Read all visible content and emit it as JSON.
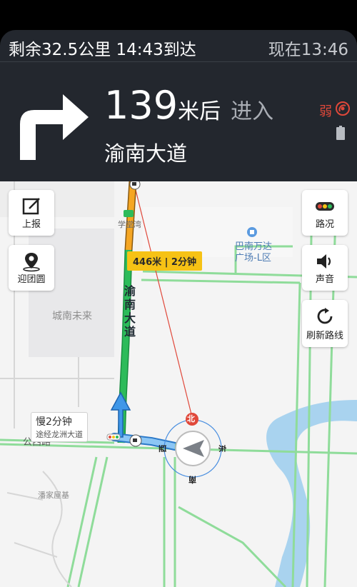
{
  "nav": {
    "remaining": "剩余32.5公里  14:43到达",
    "now": "现在13:46",
    "distance_value": "139",
    "distance_unit": "米后",
    "action": "进入",
    "road": "渝南大道",
    "signal": "弱"
  },
  "map": {
    "eta_tip": "446米 | 2分钟",
    "road_vertical": "渝南大道",
    "places": {
      "chengnan": "城南未来",
      "xuetang": "学堂湾",
      "wanda_line1": "巴南万达",
      "wanda_line2": "广场-L区",
      "gongxi": "公西路",
      "panjia": "潘家屋基"
    },
    "alt_route": {
      "line1": "慢2分钟",
      "line2": "途经龙洲大道"
    },
    "compass": {
      "north": "北",
      "east": "东",
      "south": "南",
      "west": "西"
    }
  },
  "buttons": {
    "report": "上报",
    "team": "迎团圆",
    "traffic": "路况",
    "sound": "声音",
    "refresh": "刷新路线"
  },
  "colors": {
    "panel_bg": "#23272e",
    "route_green": "#2dbb5a",
    "route_yellow": "#f5a623",
    "route_blue": "#4aa3f0",
    "signal_red": "#e0483a"
  },
  "icons": {
    "turn": "turn-right-arrow-icon",
    "signal": "signal-weak-icon",
    "battery": "battery-icon",
    "report": "edit-icon",
    "team": "location-pin-icon",
    "traffic": "traffic-light-icon",
    "sound": "speaker-icon",
    "refresh": "refresh-icon",
    "compass": "navigation-arrow-icon"
  }
}
